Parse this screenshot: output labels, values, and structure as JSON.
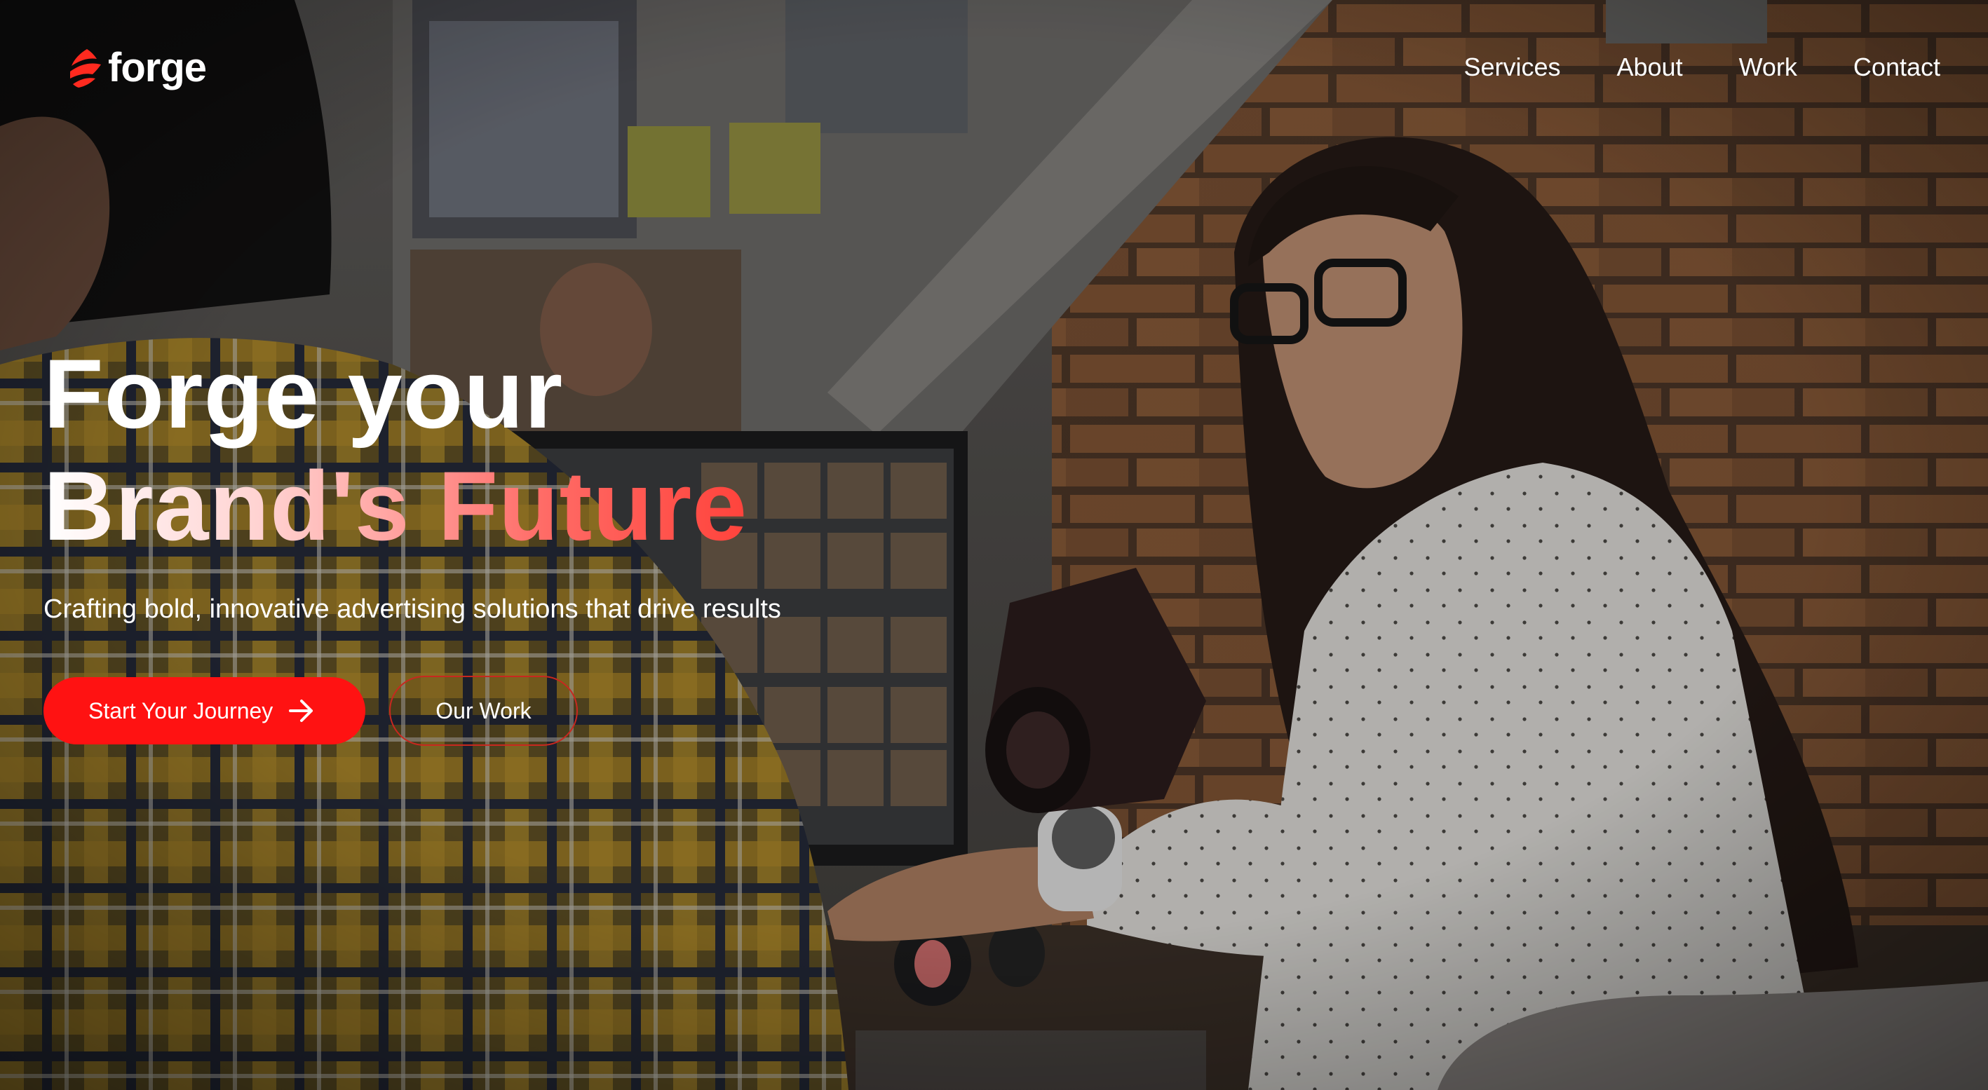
{
  "brand": {
    "name": "forge",
    "accent_color": "#ff1212"
  },
  "nav": {
    "items": [
      {
        "label": "Services"
      },
      {
        "label": "About"
      },
      {
        "label": "Work"
      },
      {
        "label": "Contact"
      }
    ]
  },
  "hero": {
    "title_line1": "Forge your",
    "title_line2": "Brand's Future",
    "subtitle": "Crafting bold, innovative advertising solutions that drive results",
    "primary_button": "Start Your Journey",
    "primary_button_icon": "arrow-right-icon",
    "secondary_button": "Our Work"
  }
}
